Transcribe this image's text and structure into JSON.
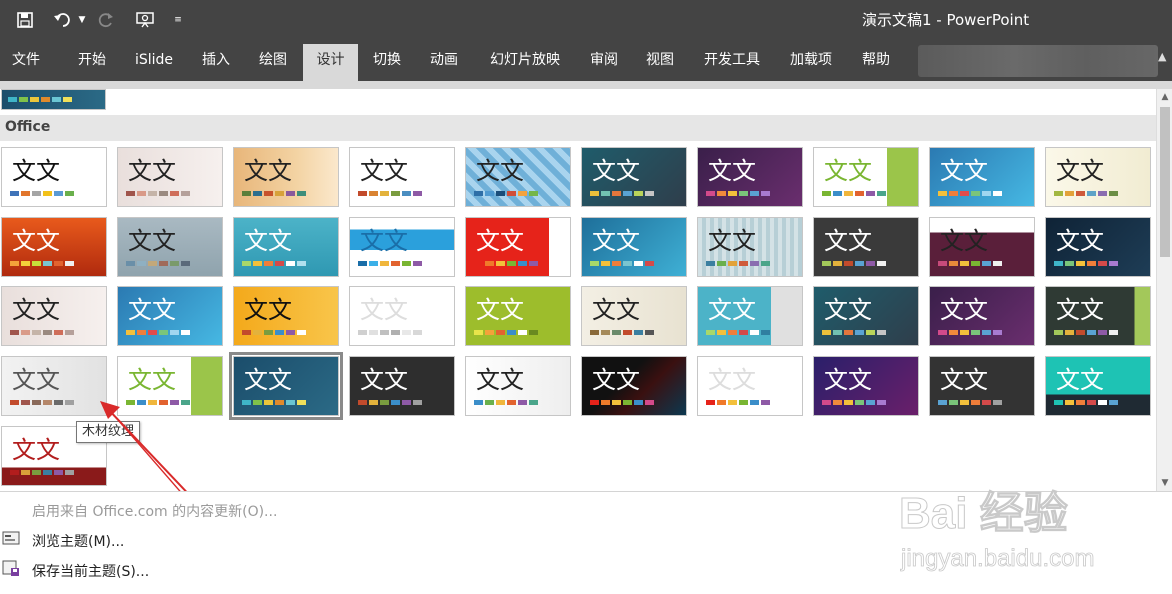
{
  "window": {
    "title": "演示文稿1  -  PowerPoint"
  },
  "qat": {
    "save_icon": "save-icon",
    "undo_icon": "undo-icon",
    "redo_icon": "redo-icon",
    "present_icon": "present-icon",
    "customize_icon": "chevron-down-icon"
  },
  "tabs": [
    {
      "label": "文件"
    },
    {
      "label": "开始"
    },
    {
      "label": "iSlide"
    },
    {
      "label": "插入"
    },
    {
      "label": "绘图"
    },
    {
      "label": "设计"
    },
    {
      "label": "切换"
    },
    {
      "label": "动画"
    },
    {
      "label": "幻灯片放映"
    },
    {
      "label": "审阅"
    },
    {
      "label": "视图"
    },
    {
      "label": "开发工具"
    },
    {
      "label": "加载项"
    },
    {
      "label": "帮助"
    }
  ],
  "gallery": {
    "section_title": "Office",
    "sample_text": "文文",
    "tooltip": "木材纹理"
  },
  "colors": {
    "titlebar": "#444444",
    "active_tab": "#d9d9d9",
    "accent_red": "#d92a2a"
  },
  "menu": {
    "update": "启用来自 Office.com 的内容更新(O)...",
    "browse": "浏览主题(M)...",
    "save": "保存当前主题(S)..."
  },
  "watermark": {
    "brand": "Bai  经验",
    "url": "jingyan.baidu.com"
  }
}
